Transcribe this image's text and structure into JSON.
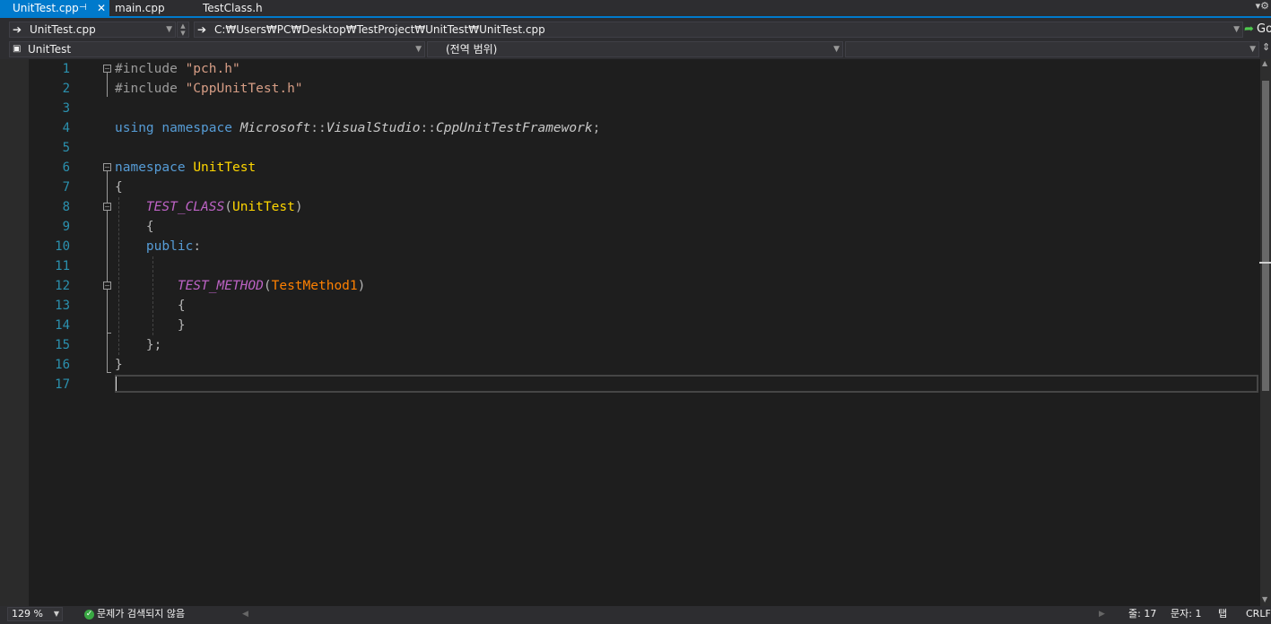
{
  "tabs": [
    {
      "label": "UnitTest.cpp",
      "active": true
    },
    {
      "label": "main.cpp",
      "active": false
    },
    {
      "label": "TestClass.h",
      "active": false
    }
  ],
  "tab_pin_icon": "⊣",
  "navbar": {
    "file_combo": "UnitTest.cpp",
    "path_combo": "C:₩Users₩PC₩Desktop₩TestProject₩UnitTest₩UnitTest.cpp",
    "go_label": "Go",
    "project_combo": "UnitTest",
    "scope_combo": "(전역 범위)",
    "member_combo": ""
  },
  "line_numbers": [
    "1",
    "2",
    "3",
    "4",
    "5",
    "6",
    "7",
    "8",
    "9",
    "10",
    "11",
    "12",
    "13",
    "14",
    "15",
    "16",
    "17"
  ],
  "code": {
    "l1_pp": "#include ",
    "l1_str": "\"pch.h\"",
    "l2_pp": "#include ",
    "l2_str": "\"CppUnitTest.h\"",
    "l4_using": "using",
    "l4_namespace": "namespace",
    "l4_ms": "Microsoft",
    "l4_sep1": "::",
    "l4_vs": "VisualStudio",
    "l4_sep2": "::",
    "l4_fw": "CppUnitTestFramework",
    "l4_semi": ";",
    "l6_namespace": "namespace",
    "l6_name": "UnitTest",
    "l7": "{",
    "l8_macro": "TEST_CLASS",
    "l8_open": "(",
    "l8_cls": "UnitTest",
    "l8_close": ")",
    "l9": "{",
    "l10_kw": "public",
    "l10_colon": ":",
    "l12_macro": "TEST_METHOD",
    "l12_open": "(",
    "l12_arg": "TestMethod1",
    "l12_close": ")",
    "l13": "{",
    "l14": "}",
    "l15": "};",
    "l16": "}"
  },
  "status": {
    "zoom": "129 %",
    "issues": "문제가 검색되지 않음",
    "line": "줄: 17",
    "col": "문자: 1",
    "tab": "탭",
    "eol": "CRLF"
  },
  "colors": {
    "accent": "#007acc",
    "keyword": "#569cd6",
    "string": "#d69d85",
    "macro": "#bd63c5",
    "class": "#ffd700",
    "line_number": "#2b91af"
  }
}
